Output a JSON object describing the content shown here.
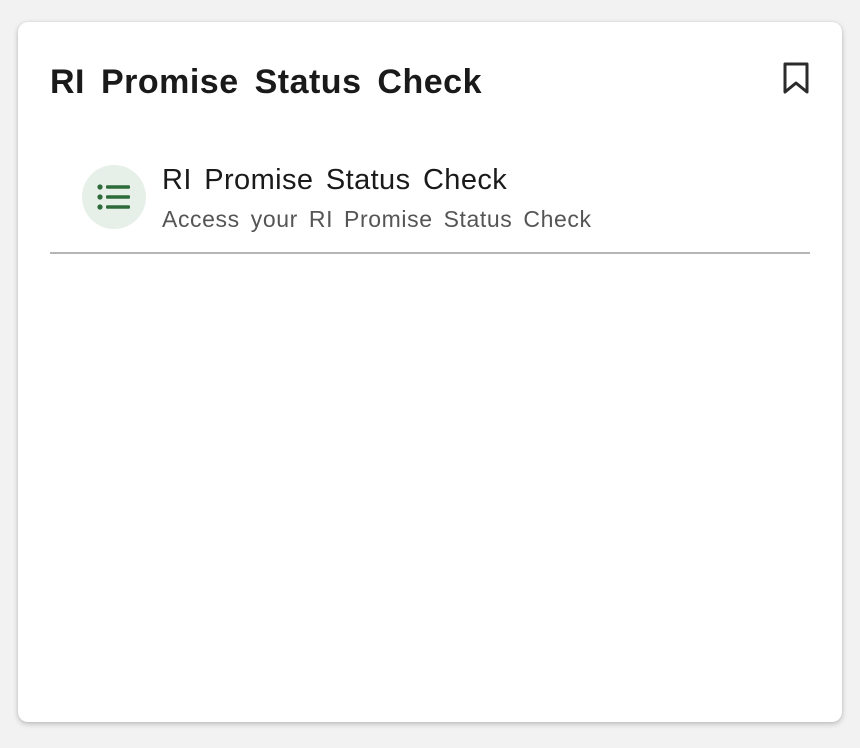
{
  "card": {
    "title": "RI Promise Status Check",
    "bookmark_icon": "bookmark-icon",
    "items": [
      {
        "title": "RI Promise Status Check",
        "subtitle": "Access your RI Promise Status Check",
        "icon": "list-icon"
      }
    ]
  },
  "colors": {
    "icon_accent": "#2e6b3a",
    "icon_background": "#e6efe8",
    "divider": "#b5b5b5"
  }
}
